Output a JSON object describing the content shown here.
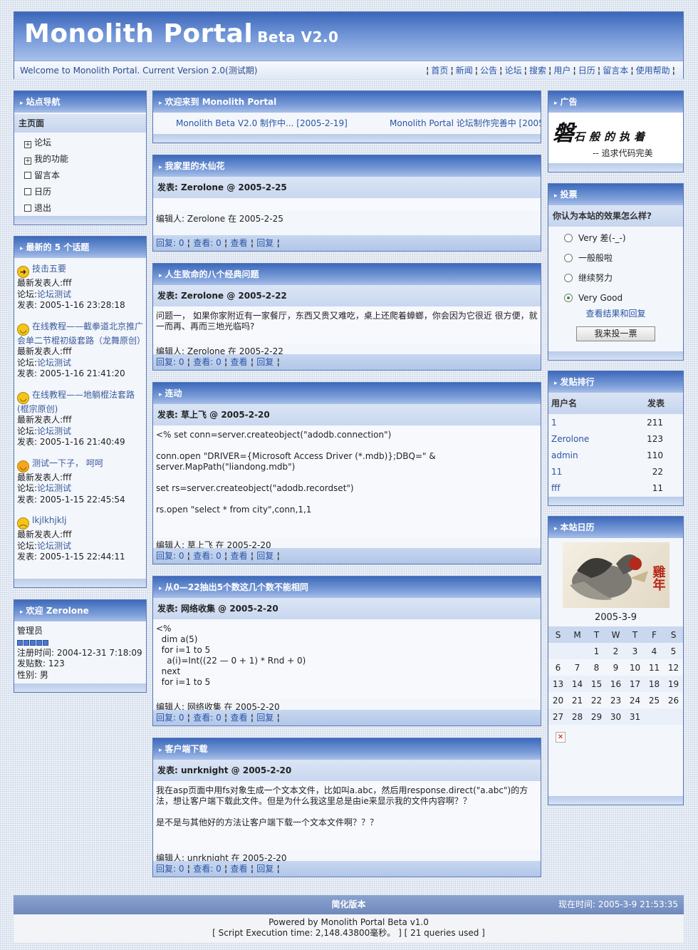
{
  "header": {
    "title": "Monolith Portal",
    "version": "Beta V2.0",
    "welcome": "Welcome to Monolith Portal. Current Version 2.0(测试期)",
    "nav": [
      "首页",
      "新闻",
      "公告",
      "论坛",
      "搜索",
      "用户",
      "日历",
      "留言本",
      "使用帮助"
    ]
  },
  "left": {
    "site_nav": {
      "title": "站点导航",
      "home": "主页面",
      "items": [
        "论坛",
        "我的功能",
        "留言本",
        "日历",
        "退出"
      ]
    },
    "latest": {
      "title": "最新的 5 个话题",
      "topics": [
        {
          "icon": "arrow",
          "title": "技击五要",
          "poster": "最新发表人:fff",
          "forum_label": "论坛:",
          "forum": "论坛测试",
          "time": "发表: 2005-1-16 23:28:18"
        },
        {
          "icon": "smile",
          "title": "在线教程——截拳道北京推广会单二节棍初级套路（龙舞原创）",
          "poster": "最新发表人:fff",
          "forum_label": "论坛:",
          "forum": "论坛测试",
          "time": "发表: 2005-1-16 21:41:20"
        },
        {
          "icon": "smile",
          "title": "在线教程——地躺棍法套路(棍宗原创)",
          "poster": "最新发表人:fff",
          "forum_label": "论坛:",
          "forum": "论坛测试",
          "time": "发表: 2005-1-16 21:40:49"
        },
        {
          "icon": "grin",
          "title": "测试一下子， 呵呵",
          "poster": "最新发表人:fff",
          "forum_label": "论坛:",
          "forum": "论坛测试",
          "time": "发表: 2005-1-15 22:45:54"
        },
        {
          "icon": "sad",
          "title": "lkjlkhjklj",
          "poster": "最新发表人:fff",
          "forum_label": "论坛:",
          "forum": "论坛测试",
          "time": "发表: 2005-1-15 22:44:11"
        }
      ]
    },
    "welcome": {
      "title": "欢迎 Zerolone",
      "role": "管理员",
      "register": "注册时间: 2004-12-31 7:18:09",
      "posts": "发贴数: 123",
      "gender": "性别: 男"
    }
  },
  "center": {
    "welcome_title": "欢迎来到 Monolith Portal",
    "ticker": [
      "Monolith Beta V2.0 制作中... [2005-2-19]",
      "Monolith Portal 论坛制作完善中 [2005"
    ],
    "posts": [
      {
        "title": "我家里的水仙花",
        "meta": "发表: Zerolone @ 2005-2-25",
        "body": [],
        "edit": "编辑人: Zerolone 在 2005-2-25",
        "footer": {
          "reply": "回复: 0",
          "view1": "查看: 0",
          "view2": "查看",
          "reply2": "回复"
        }
      },
      {
        "title": "人生致命的八个经典问题",
        "meta": "发表: Zerolone @ 2005-2-22",
        "body": [
          "问题一， 如果你家附近有一家餐厅，东西又贵又难吃，桌上还爬着蟑螂，你会因为它很近 很方便，就一而再、再而三地光临吗?"
        ],
        "edit": "编辑人: Zerolone 在 2005-2-22",
        "footer": {
          "reply": "回复: 0",
          "view1": "查看: 0",
          "view2": "查看",
          "reply2": "回复"
        }
      },
      {
        "title": "连动",
        "meta": "发表: 草上飞 @ 2005-2-20",
        "body": [
          "<% set conn=server.createobject(\"adodb.connection\")",
          "",
          "conn.open \"DRIVER={Microsoft Access Driver (*.mdb)};DBQ=\" & server.MapPath(\"liandong.mdb\")",
          "",
          "set rs=server.createobject(\"adodb.recordset\")",
          "",
          "rs.open \"select * from city\",conn,1,1",
          "",
          ""
        ],
        "edit": "编辑人: 草上飞 在 2005-2-20",
        "footer": {
          "reply": "回复: 0",
          "view1": "查看: 0",
          "view2": "查看",
          "reply2": "回复"
        }
      },
      {
        "title": "从0—22抽出5个数这几个数不能相同",
        "meta": "发表: 网络收集 @ 2005-2-20",
        "body": [
          "<%",
          "  dim a(5)",
          "  for i=1 to 5",
          "    a(i)=Int((22 — 0 + 1) * Rnd + 0)",
          "  next",
          "  for i=1 to 5"
        ],
        "edit": "编辑人: 网络收集 在 2005-2-20",
        "footer": {
          "reply": "回复: 0",
          "view1": "查看: 0",
          "view2": "查看",
          "reply2": "回复"
        }
      },
      {
        "title": "客户端下载",
        "meta": "发表: unrknight @ 2005-2-20",
        "body": [
          "我在asp页面中用fs对象生成一个文本文件，比如叫a.abc，然后用response.direct(\"a.abc\")的方法，想让客户端下载此文件。但是为什么我这里总是由ie来显示我的文件内容啊？？",
          "",
          "是不是与其他好的方法让客户端下载一个文本文件啊？？？",
          "",
          ""
        ],
        "edit": "编辑人: unrknight 在 2005-2-20",
        "footer": {
          "reply": "回复: 0",
          "view1": "查看: 0",
          "view2": "查看",
          "reply2": "回复"
        }
      }
    ]
  },
  "right": {
    "ad": {
      "title": "广告",
      "slogan": "磐石般的执着",
      "sub": "-- 追求代码完美"
    },
    "poll": {
      "title": "投票",
      "question": "你认为本站的效果怎么样?",
      "options": [
        "Very 差(-_-)",
        "一般般啦",
        "继续努力",
        "Very Good"
      ],
      "selected_index": 3,
      "results_link": "查看结果和回复",
      "vote_button": "我来投一票"
    },
    "rank": {
      "title": "发贴排行",
      "col_user": "用户名",
      "col_posts": "发表",
      "rows": [
        {
          "user": "1",
          "posts": "211"
        },
        {
          "user": "Zerolone",
          "posts": "123"
        },
        {
          "user": "admin",
          "posts": "110"
        },
        {
          "user": "11",
          "posts": "22"
        },
        {
          "user": "fff",
          "posts": "11"
        }
      ]
    },
    "calendar": {
      "title": "本站日历",
      "image_text": "雞年",
      "date": "2005-3-9",
      "weekdays": [
        "S",
        "M",
        "T",
        "W",
        "T",
        "F",
        "S"
      ],
      "weeks": [
        [
          "",
          "",
          "1",
          "2",
          "3",
          "4",
          "5"
        ],
        [
          "6",
          "7",
          "8",
          "9",
          "10",
          "11",
          "12"
        ],
        [
          "13",
          "14",
          "15",
          "16",
          "17",
          "18",
          "19"
        ],
        [
          "20",
          "21",
          "22",
          "23",
          "24",
          "25",
          "26"
        ],
        [
          "27",
          "28",
          "29",
          "30",
          "31",
          "",
          ""
        ]
      ]
    }
  },
  "footer": {
    "simple_version": "简化版本",
    "now": "现在时间: 2005-3-9 21:53:35",
    "powered": "Powered by Monolith Portal Beta v1.0",
    "stats": "[ Script Execution time: 2,148.43800毫秒。 ] [ 21 queries used ]"
  },
  "colors": {
    "accent": "#3d69bb",
    "link": "#2a55a3",
    "border": "#5b7ab6"
  }
}
